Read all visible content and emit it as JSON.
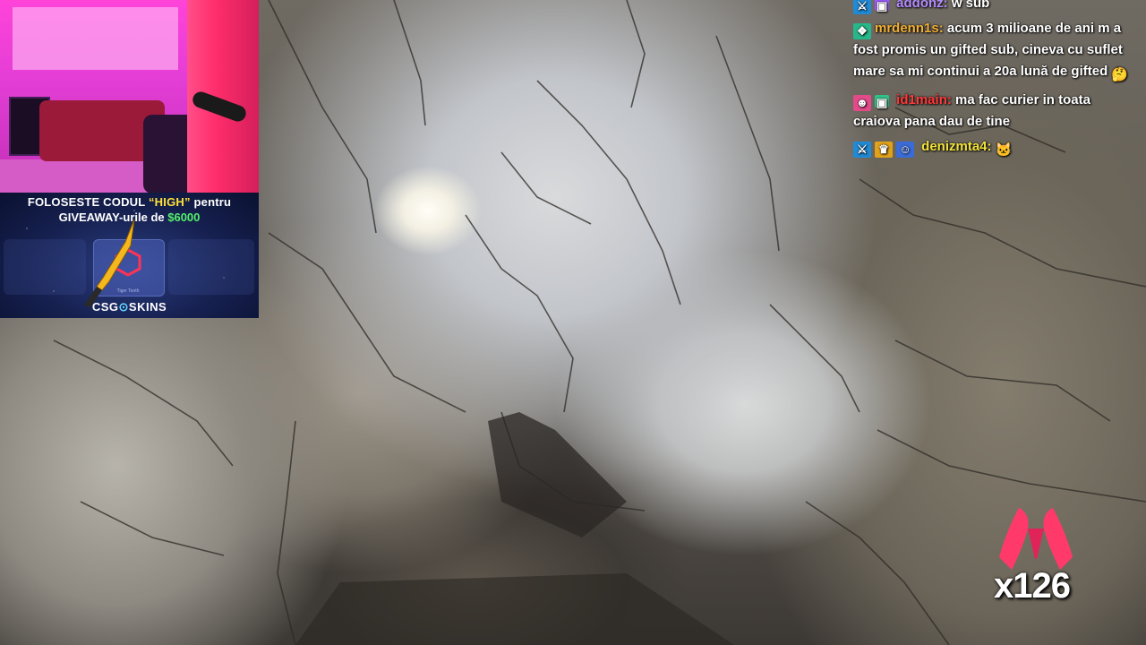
{
  "banner": {
    "line1_prefix": "FOLOSESTE CODUL ",
    "line1_code": "“HIGH”",
    "line1_suffix": " pentru",
    "line2_prefix": "GIVEAWAY-urile de ",
    "line2_amount": "$6000",
    "card_label": "Tiger Tooth",
    "brand_left": "CSG",
    "brand_right": "SKINS"
  },
  "chat": {
    "messages": [
      {
        "user": "addonz:",
        "text": "w sub",
        "badges": [
          "sword-badge",
          "gift-badge"
        ]
      },
      {
        "user": "mrdenn1s:",
        "text": "acum 3 milioane de ani m a fost promis un gifted sub, cineva cu suflet mare sa mi continui a 20a lună de gifted",
        "badges": [
          "tier-badge"
        ]
      },
      {
        "user": "id1main:",
        "text": "ma fac curier in toata craiova pana dau de tine",
        "badges": [
          "monster-badge",
          "gift-badge"
        ]
      },
      {
        "user": "denizmta4:",
        "text": "",
        "badges": [
          "sword-badge",
          "crown-badge",
          "alien-badge"
        ]
      }
    ]
  },
  "reaction": {
    "count": "x126",
    "icon": "praying-hands-icon"
  },
  "colors": {
    "user1": "#b58cff",
    "user2": "#f2b035",
    "user3": "#ff3a3a",
    "user4": "#f2e23a",
    "code_highlight": "#ffe23a",
    "amount_highlight": "#53f06a"
  }
}
